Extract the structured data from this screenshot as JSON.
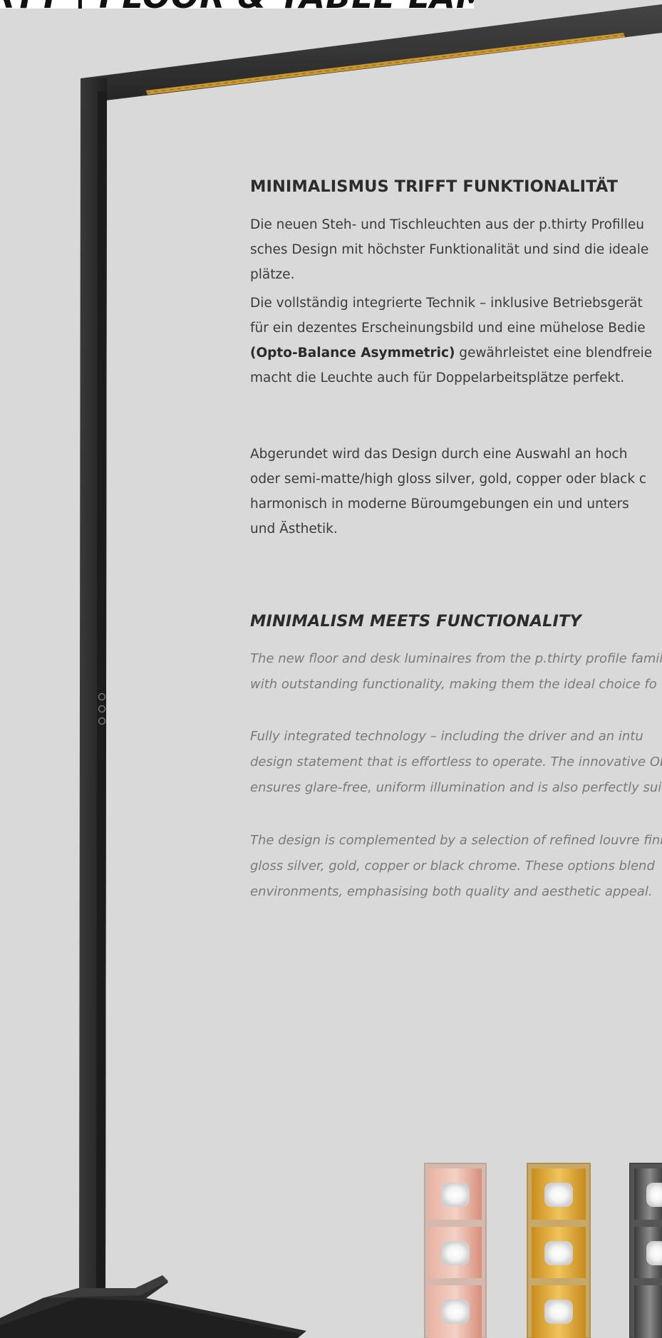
{
  "banner": {
    "title": "RTY | FLOOR & TABLE LAMPS"
  },
  "german": {
    "heading": "MINIMALISMUS TRIFFT FUNKTIONALITÄT",
    "p1": [
      "Die neuen Steh- und Tischleuchten aus der p.thirty Profilleu",
      "sches Design mit höchster Funktionalität und sind die ideale",
      "plätze."
    ],
    "p2": [
      {
        "pre": "Die vollständig integrierte Technik – inklusive Betriebsgerät",
        "bold": "",
        "post": ""
      },
      {
        "pre": "für ein dezentes Erscheinungsbild und eine mühelose Bedie",
        "bold": "",
        "post": ""
      },
      {
        "pre": "",
        "bold": "(Opto-Balance Asymmetric)",
        "post": " gewährleistet eine blendfreie"
      },
      {
        "pre": "macht die Leuchte auch für Doppelarbeitsplätze perfekt.",
        "bold": "",
        "post": ""
      }
    ],
    "p3": [
      "Abgerundet wird das Design durch eine Auswahl an hoch",
      "oder semi-matte/high gloss silver, gold, copper oder black c",
      "harmonisch in moderne Büroumgebungen ein und unters",
      "und Ästhetik."
    ]
  },
  "english": {
    "heading": "MINIMALISM MEETS FUNCTIONALITY",
    "p1": [
      "The new floor and desk luminaires from the p.thirty profile famil",
      "with outstanding functionality, making them the ideal choice fo"
    ],
    "p2": [
      "Fully integrated technology – including the driver and an intu",
      "design statement that is effortless to operate. The innovative OB",
      "ensures glare-free, uniform illumination and is also perfectly suit"
    ],
    "p3": [
      "The design is complemented by a selection of refined louvre fini",
      "gloss silver, gold, copper or black chrome. These options blend",
      "environments, emphasising both quality and aesthetic appeal."
    ]
  },
  "colors": {
    "background": "#d9d9d9",
    "lamp": "#2d2d2d",
    "led_strip": "#c9962f",
    "louvre_copper": "#e3a08d",
    "louvre_gold": "#d9a233",
    "louvre_black_chrome": "#4a4a4a"
  }
}
